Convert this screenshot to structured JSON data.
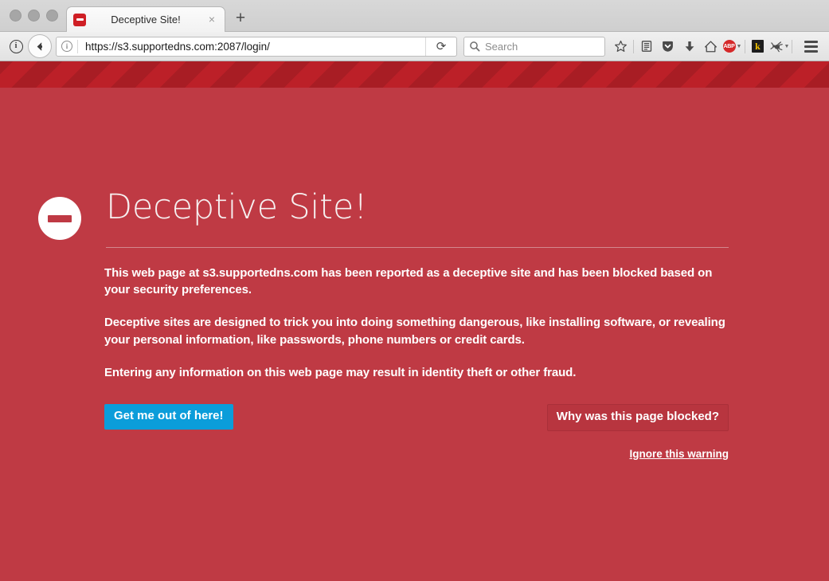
{
  "window": {
    "traffic_lights": [
      "close",
      "minimize",
      "zoom"
    ]
  },
  "tabbar": {
    "tabs": [
      {
        "favicon": "deceptive-site-favicon",
        "title": "Deceptive Site!",
        "close_label": "×"
      }
    ],
    "new_tab_label": "+"
  },
  "navbar": {
    "page_info_icon": "page-info-icon",
    "page_info_glyph": "i",
    "back_icon": "back-arrow-icon",
    "url_identity_glyph": "i",
    "url": "https://s3.supportedns.com:2087/login/",
    "reload_icon": "reload-icon",
    "reload_glyph": "⟳",
    "search": {
      "icon": "search-icon",
      "placeholder": "Search",
      "value": ""
    },
    "icons": [
      {
        "name": "bookmark-star-icon",
        "label": "☆"
      },
      {
        "name": "reading-list-icon",
        "label": ""
      },
      {
        "name": "pocket-icon",
        "label": ""
      },
      {
        "name": "downloads-icon",
        "label": "↓"
      },
      {
        "name": "home-icon",
        "label": ""
      },
      {
        "name": "adblock-plus-icon",
        "label": "ABP"
      },
      {
        "name": "kaspersky-icon",
        "label": "k"
      },
      {
        "name": "bug-extension-icon",
        "label": ""
      }
    ],
    "menu_icon": "hamburger-menu-icon"
  },
  "warning": {
    "stripes": "hazard-stripes-band",
    "shield_icon": "no-entry-icon",
    "title": "Deceptive Site!",
    "paragraphs": [
      "This web page at s3.supportedns.com has been reported as a deceptive site and has been blocked based on your security preferences.",
      "Deceptive sites are designed to trick you into doing something dangerous, like installing software, or revealing your personal information, like passwords, phone numbers or credit cards.",
      "Entering any information on this web page may result in identity theft or other fraud."
    ],
    "primary_button": "Get me out of here!",
    "secondary_button": "Why was this page blocked?",
    "ignore_link": "Ignore this warning"
  },
  "colors": {
    "page_background": "#bf3a44",
    "stripe_dark": "#a81d24",
    "stripe_light": "#bc2028",
    "primary_button": "#0b9dda",
    "secondary_button": "#b8353f",
    "text": "#ffffff",
    "favicon_red": "#cf1f25"
  }
}
